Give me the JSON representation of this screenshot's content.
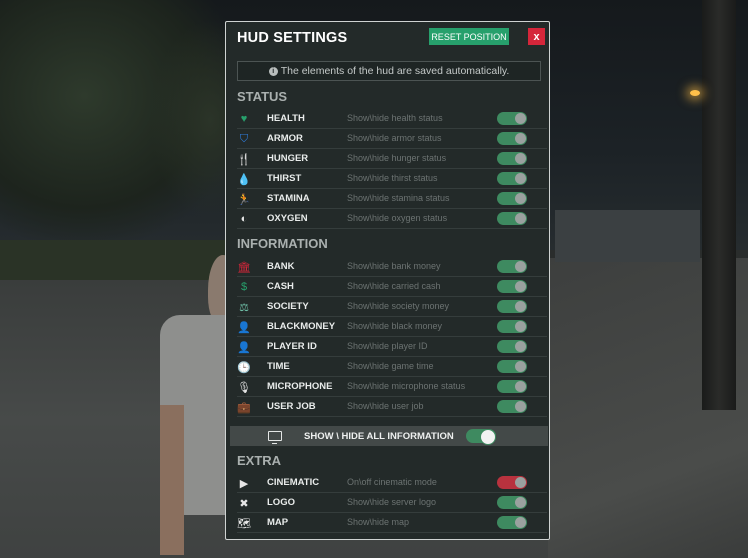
{
  "panel": {
    "title": "HUD SETTINGS",
    "reset_label": "RESET POSITION",
    "close_label": "x",
    "notice_icon": "i",
    "notice": "The elements of the hud are saved automatically."
  },
  "status": {
    "title": "STATUS",
    "items": [
      {
        "label": "HEALTH",
        "desc": "Show\\hide health status",
        "icon": "heart-icon",
        "glyph": "♥",
        "color": "#27a06c",
        "enabled": true
      },
      {
        "label": "ARMOR",
        "desc": "Show\\hide armor status",
        "icon": "shield-icon",
        "glyph": "⛉",
        "color": "#2f7fe0",
        "enabled": true
      },
      {
        "label": "HUNGER",
        "desc": "Show\\hide hunger status",
        "icon": "utensils-icon",
        "glyph": "🍴",
        "color": "#d5263a",
        "enabled": true
      },
      {
        "label": "THIRST",
        "desc": "Show\\hide thirst status",
        "icon": "droplet-icon",
        "glyph": "💧",
        "color": "#3a9ad8",
        "enabled": true
      },
      {
        "label": "STAMINA",
        "desc": "Show\\hide stamina status",
        "icon": "running-icon",
        "glyph": "🏃",
        "color": "#e0b43a",
        "enabled": true
      },
      {
        "label": "OXYGEN",
        "desc": "Show\\hide oxygen status",
        "icon": "lungs-icon",
        "glyph": "◐",
        "color": "#e6e6e6",
        "enabled": true
      }
    ]
  },
  "information": {
    "title": "INFORMATION",
    "items": [
      {
        "label": "BANK",
        "desc": "Show\\hide bank money",
        "icon": "bank-icon",
        "glyph": "🏛",
        "color": "#d5263a",
        "enabled": true
      },
      {
        "label": "CASH",
        "desc": "Show\\hide carried cash",
        "icon": "dollar-icon",
        "glyph": "$",
        "color": "#27a06c",
        "enabled": true
      },
      {
        "label": "SOCIETY",
        "desc": "Show\\hide society money",
        "icon": "scale-icon",
        "glyph": "⚖",
        "color": "#6fc0a8",
        "enabled": true
      },
      {
        "label": "BLACKMONEY",
        "desc": "Show\\hide black money",
        "icon": "spy-icon",
        "glyph": "👤",
        "color": "#9a9f9e",
        "enabled": true
      },
      {
        "label": "PLAYER ID",
        "desc": "Show\\hide player ID",
        "icon": "user-icon",
        "glyph": "👤",
        "color": "#e6e6e6",
        "enabled": true
      },
      {
        "label": "TIME",
        "desc": "Show\\hide game time",
        "icon": "clock-icon",
        "glyph": "🕒",
        "color": "#e6e6e6",
        "enabled": true
      },
      {
        "label": "MICROPHONE",
        "desc": "Show\\hide microphone status",
        "icon": "microphone-icon",
        "glyph": "🎙",
        "color": "#e6e6e6",
        "enabled": true
      },
      {
        "label": "USER JOB",
        "desc": "Show\\hide user job",
        "icon": "briefcase-icon",
        "glyph": "💼",
        "color": "#e6e6e6",
        "enabled": true
      }
    ]
  },
  "show_all": {
    "label": "SHOW \\ HIDE ALL INFORMATION",
    "enabled": true
  },
  "extra": {
    "title": "EXTRA",
    "items": [
      {
        "label": "CINEMATIC",
        "desc": "On\\off cinematic mode",
        "icon": "video-icon",
        "glyph": "▶",
        "color": "#e6e6e6",
        "enabled": false
      },
      {
        "label": "LOGO",
        "desc": "Show\\hide server logo",
        "icon": "x-circle-icon",
        "glyph": "✖",
        "color": "#e6e6e6",
        "enabled": true
      },
      {
        "label": "MAP",
        "desc": "Show\\hide map",
        "icon": "map-icon",
        "glyph": "🗺",
        "color": "#e6e6e6",
        "enabled": true
      }
    ]
  }
}
